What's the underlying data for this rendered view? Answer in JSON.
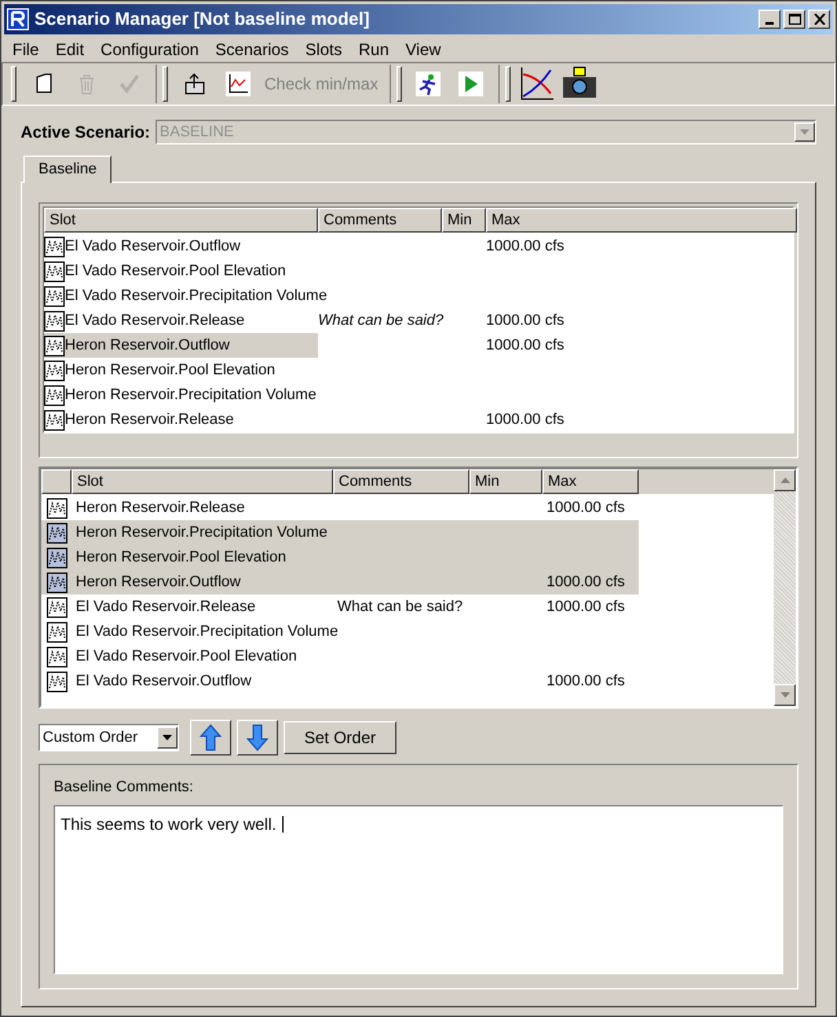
{
  "window": {
    "title": "Scenario Manager [Not baseline model]"
  },
  "menu": [
    "File",
    "Edit",
    "Configuration",
    "Scenarios",
    "Slots",
    "Run",
    "View"
  ],
  "toolbar": [
    {
      "kind": "new",
      "disabled": false
    },
    {
      "kind": "delete",
      "disabled": true
    },
    {
      "kind": "check",
      "disabled": true
    },
    {
      "kind": "sep"
    },
    {
      "kind": "export",
      "disabled": false
    },
    {
      "kind": "plot",
      "disabled": false
    },
    {
      "kind": "text",
      "label": "Check min/max",
      "disabled": true
    },
    {
      "kind": "sep"
    },
    {
      "kind": "runner",
      "disabled": false
    },
    {
      "kind": "play",
      "disabled": false
    },
    {
      "kind": "sep"
    },
    {
      "kind": "chart",
      "disabled": false
    },
    {
      "kind": "camera",
      "disabled": false
    }
  ],
  "active_scenario": {
    "label": "Active Scenario:",
    "value": "BASELINE"
  },
  "tabs": [
    {
      "label": "Baseline",
      "selected": true
    }
  ],
  "upper_table": {
    "columns": [
      "Slot",
      "Comments",
      "Min",
      "Max"
    ],
    "rows": [
      {
        "slot": "El Vado Reservoir.Outflow",
        "comments": "",
        "min": "",
        "max": "1000.00 cfs",
        "selected": false
      },
      {
        "slot": "El Vado Reservoir.Pool Elevation",
        "comments": "",
        "min": "",
        "max": "",
        "selected": false
      },
      {
        "slot": "El Vado Reservoir.Precipitation Volume",
        "comments": "",
        "min": "",
        "max": "",
        "selected": false
      },
      {
        "slot": "El Vado Reservoir.Release",
        "comments": "What can be said?",
        "min": "",
        "max": "1000.00 cfs",
        "selected": false
      },
      {
        "slot": "Heron Reservoir.Outflow",
        "comments": "",
        "min": "",
        "max": "1000.00 cfs",
        "selected": true
      },
      {
        "slot": "Heron Reservoir.Pool Elevation",
        "comments": "",
        "min": "",
        "max": "",
        "selected": false
      },
      {
        "slot": "Heron Reservoir.Precipitation Volume",
        "comments": "",
        "min": "",
        "max": "",
        "selected": false
      },
      {
        "slot": "Heron Reservoir.Release",
        "comments": "",
        "min": "",
        "max": "1000.00 cfs",
        "selected": false
      }
    ]
  },
  "lower_table": {
    "columns": [
      "Slot",
      "Comments",
      "Min",
      "Max"
    ],
    "rows": [
      {
        "slot": "Heron Reservoir.Release",
        "comments": "",
        "min": "",
        "max": "1000.00 cfs",
        "selected": false
      },
      {
        "slot": "Heron Reservoir.Precipitation Volume",
        "comments": "",
        "min": "",
        "max": "",
        "selected": true
      },
      {
        "slot": "Heron Reservoir.Pool Elevation",
        "comments": "",
        "min": "",
        "max": "",
        "selected": true
      },
      {
        "slot": "Heron Reservoir.Outflow",
        "comments": "",
        "min": "",
        "max": "1000.00 cfs",
        "selected": true
      },
      {
        "slot": "El Vado Reservoir.Release",
        "comments": "What can be said?",
        "min": "",
        "max": "1000.00 cfs",
        "selected": false
      },
      {
        "slot": "El Vado Reservoir.Precipitation Volume",
        "comments": "",
        "min": "",
        "max": "",
        "selected": false
      },
      {
        "slot": "El Vado Reservoir.Pool Elevation",
        "comments": "",
        "min": "",
        "max": "",
        "selected": false
      },
      {
        "slot": "El Vado Reservoir.Outflow",
        "comments": "",
        "min": "",
        "max": "1000.00 cfs",
        "selected": false
      }
    ]
  },
  "order": {
    "value": "Custom Order",
    "set_button": "Set Order"
  },
  "comments": {
    "label": "Baseline Comments:",
    "value": "This seems to work very well."
  }
}
